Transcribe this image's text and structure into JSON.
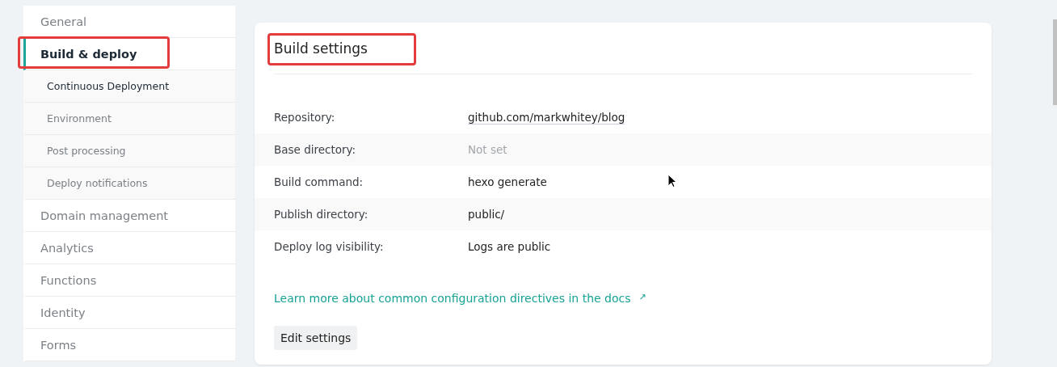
{
  "sidebar": {
    "items": [
      {
        "label": "General",
        "selected": false,
        "highlighted": false
      },
      {
        "label": "Build & deploy",
        "selected": true,
        "highlighted": true,
        "children": [
          {
            "label": "Continuous Deployment",
            "selected": true
          },
          {
            "label": "Environment",
            "selected": false
          },
          {
            "label": "Post processing",
            "selected": false
          },
          {
            "label": "Deploy notifications",
            "selected": false
          }
        ]
      },
      {
        "label": "Domain management",
        "selected": false,
        "highlighted": false
      },
      {
        "label": "Analytics",
        "selected": false,
        "highlighted": false
      },
      {
        "label": "Functions",
        "selected": false,
        "highlighted": false
      },
      {
        "label": "Identity",
        "selected": false,
        "highlighted": false
      },
      {
        "label": "Forms",
        "selected": false,
        "highlighted": false
      }
    ]
  },
  "card": {
    "title": "Build settings",
    "title_highlighted": true,
    "rows": [
      {
        "label": "Repository:",
        "value": "github.com/markwhitey/blog",
        "kind": "link"
      },
      {
        "label": "Base directory:",
        "value": "Not set",
        "kind": "muted"
      },
      {
        "label": "Build command:",
        "value": "hexo generate",
        "kind": "plain"
      },
      {
        "label": "Publish directory:",
        "value": "public/",
        "kind": "plain"
      },
      {
        "label": "Deploy log visibility:",
        "value": "Logs are public",
        "kind": "plain"
      }
    ],
    "docs_link": "Learn more about common configuration directives in the docs",
    "docs_link_arrow": "↗",
    "button": "Edit settings"
  }
}
